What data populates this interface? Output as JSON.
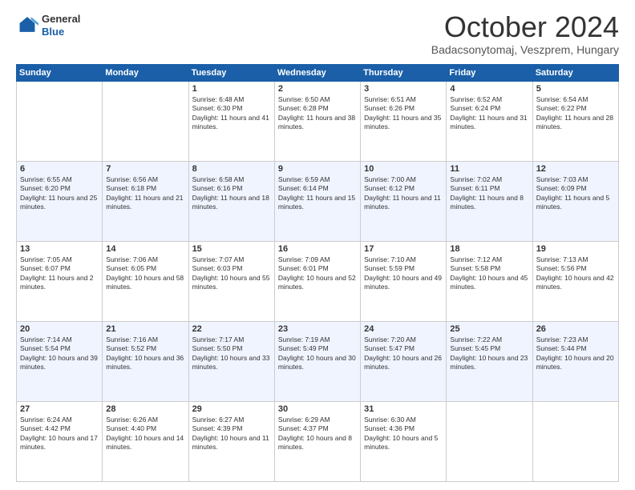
{
  "header": {
    "logo": {
      "general": "General",
      "blue": "Blue"
    },
    "title": "October 2024",
    "location": "Badacsonytomaj, Veszprem, Hungary"
  },
  "weekdays": [
    "Sunday",
    "Monday",
    "Tuesday",
    "Wednesday",
    "Thursday",
    "Friday",
    "Saturday"
  ],
  "weeks": [
    [
      {
        "day": "",
        "data": ""
      },
      {
        "day": "",
        "data": ""
      },
      {
        "day": "1",
        "data": "Sunrise: 6:48 AM\nSunset: 6:30 PM\nDaylight: 11 hours and 41 minutes."
      },
      {
        "day": "2",
        "data": "Sunrise: 6:50 AM\nSunset: 6:28 PM\nDaylight: 11 hours and 38 minutes."
      },
      {
        "day": "3",
        "data": "Sunrise: 6:51 AM\nSunset: 6:26 PM\nDaylight: 11 hours and 35 minutes."
      },
      {
        "day": "4",
        "data": "Sunrise: 6:52 AM\nSunset: 6:24 PM\nDaylight: 11 hours and 31 minutes."
      },
      {
        "day": "5",
        "data": "Sunrise: 6:54 AM\nSunset: 6:22 PM\nDaylight: 11 hours and 28 minutes."
      }
    ],
    [
      {
        "day": "6",
        "data": "Sunrise: 6:55 AM\nSunset: 6:20 PM\nDaylight: 11 hours and 25 minutes."
      },
      {
        "day": "7",
        "data": "Sunrise: 6:56 AM\nSunset: 6:18 PM\nDaylight: 11 hours and 21 minutes."
      },
      {
        "day": "8",
        "data": "Sunrise: 6:58 AM\nSunset: 6:16 PM\nDaylight: 11 hours and 18 minutes."
      },
      {
        "day": "9",
        "data": "Sunrise: 6:59 AM\nSunset: 6:14 PM\nDaylight: 11 hours and 15 minutes."
      },
      {
        "day": "10",
        "data": "Sunrise: 7:00 AM\nSunset: 6:12 PM\nDaylight: 11 hours and 11 minutes."
      },
      {
        "day": "11",
        "data": "Sunrise: 7:02 AM\nSunset: 6:11 PM\nDaylight: 11 hours and 8 minutes."
      },
      {
        "day": "12",
        "data": "Sunrise: 7:03 AM\nSunset: 6:09 PM\nDaylight: 11 hours and 5 minutes."
      }
    ],
    [
      {
        "day": "13",
        "data": "Sunrise: 7:05 AM\nSunset: 6:07 PM\nDaylight: 11 hours and 2 minutes."
      },
      {
        "day": "14",
        "data": "Sunrise: 7:06 AM\nSunset: 6:05 PM\nDaylight: 10 hours and 58 minutes."
      },
      {
        "day": "15",
        "data": "Sunrise: 7:07 AM\nSunset: 6:03 PM\nDaylight: 10 hours and 55 minutes."
      },
      {
        "day": "16",
        "data": "Sunrise: 7:09 AM\nSunset: 6:01 PM\nDaylight: 10 hours and 52 minutes."
      },
      {
        "day": "17",
        "data": "Sunrise: 7:10 AM\nSunset: 5:59 PM\nDaylight: 10 hours and 49 minutes."
      },
      {
        "day": "18",
        "data": "Sunrise: 7:12 AM\nSunset: 5:58 PM\nDaylight: 10 hours and 45 minutes."
      },
      {
        "day": "19",
        "data": "Sunrise: 7:13 AM\nSunset: 5:56 PM\nDaylight: 10 hours and 42 minutes."
      }
    ],
    [
      {
        "day": "20",
        "data": "Sunrise: 7:14 AM\nSunset: 5:54 PM\nDaylight: 10 hours and 39 minutes."
      },
      {
        "day": "21",
        "data": "Sunrise: 7:16 AM\nSunset: 5:52 PM\nDaylight: 10 hours and 36 minutes."
      },
      {
        "day": "22",
        "data": "Sunrise: 7:17 AM\nSunset: 5:50 PM\nDaylight: 10 hours and 33 minutes."
      },
      {
        "day": "23",
        "data": "Sunrise: 7:19 AM\nSunset: 5:49 PM\nDaylight: 10 hours and 30 minutes."
      },
      {
        "day": "24",
        "data": "Sunrise: 7:20 AM\nSunset: 5:47 PM\nDaylight: 10 hours and 26 minutes."
      },
      {
        "day": "25",
        "data": "Sunrise: 7:22 AM\nSunset: 5:45 PM\nDaylight: 10 hours and 23 minutes."
      },
      {
        "day": "26",
        "data": "Sunrise: 7:23 AM\nSunset: 5:44 PM\nDaylight: 10 hours and 20 minutes."
      }
    ],
    [
      {
        "day": "27",
        "data": "Sunrise: 6:24 AM\nSunset: 4:42 PM\nDaylight: 10 hours and 17 minutes."
      },
      {
        "day": "28",
        "data": "Sunrise: 6:26 AM\nSunset: 4:40 PM\nDaylight: 10 hours and 14 minutes."
      },
      {
        "day": "29",
        "data": "Sunrise: 6:27 AM\nSunset: 4:39 PM\nDaylight: 10 hours and 11 minutes."
      },
      {
        "day": "30",
        "data": "Sunrise: 6:29 AM\nSunset: 4:37 PM\nDaylight: 10 hours and 8 minutes."
      },
      {
        "day": "31",
        "data": "Sunrise: 6:30 AM\nSunset: 4:36 PM\nDaylight: 10 hours and 5 minutes."
      },
      {
        "day": "",
        "data": ""
      },
      {
        "day": "",
        "data": ""
      }
    ]
  ]
}
